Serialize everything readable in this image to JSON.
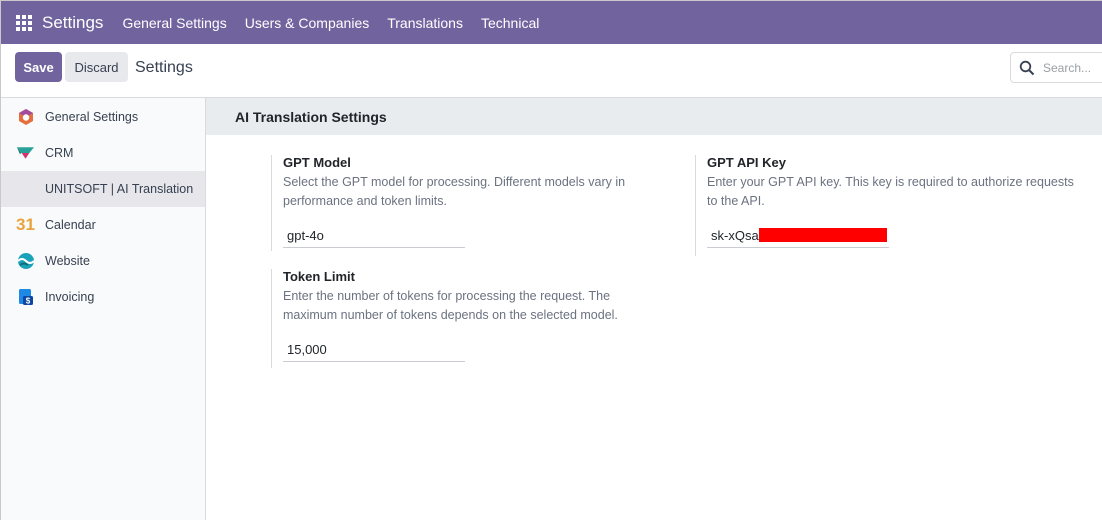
{
  "navbar": {
    "brand": "Settings",
    "items": [
      "General Settings",
      "Users & Companies",
      "Translations",
      "Technical"
    ]
  },
  "control": {
    "save_label": "Save",
    "discard_label": "Discard",
    "breadcrumb": "Settings",
    "search_placeholder": "Search..."
  },
  "sidebar": {
    "items": [
      {
        "label": "General Settings",
        "icon": "odoo-hexagon-icon"
      },
      {
        "label": "CRM",
        "icon": "crm-icon"
      },
      {
        "label": "UNITSOFT | AI Translation",
        "icon": ""
      },
      {
        "label": "Calendar",
        "icon": "calendar-31-icon",
        "icon_text": "31"
      },
      {
        "label": "Website",
        "icon": "website-icon"
      },
      {
        "label": "Invoicing",
        "icon": "invoicing-icon"
      }
    ]
  },
  "main": {
    "section_title": "AI Translation Settings",
    "settings": [
      {
        "title": "GPT Model",
        "description": "Select the GPT model for processing. Different models vary in performance and token limits.",
        "value": "gpt-4o"
      },
      {
        "title": "GPT API Key",
        "description": "Enter your GPT API key. This key is required to authorize requests to the API.",
        "value": "sk-xQsa"
      },
      {
        "title": "Token Limit",
        "description": "Enter the number of tokens for processing the request. The maximum number of tokens depends on the selected model.",
        "value": "15,000"
      }
    ]
  },
  "colors": {
    "brand": "#71639e",
    "redaction": "#ff0000"
  }
}
